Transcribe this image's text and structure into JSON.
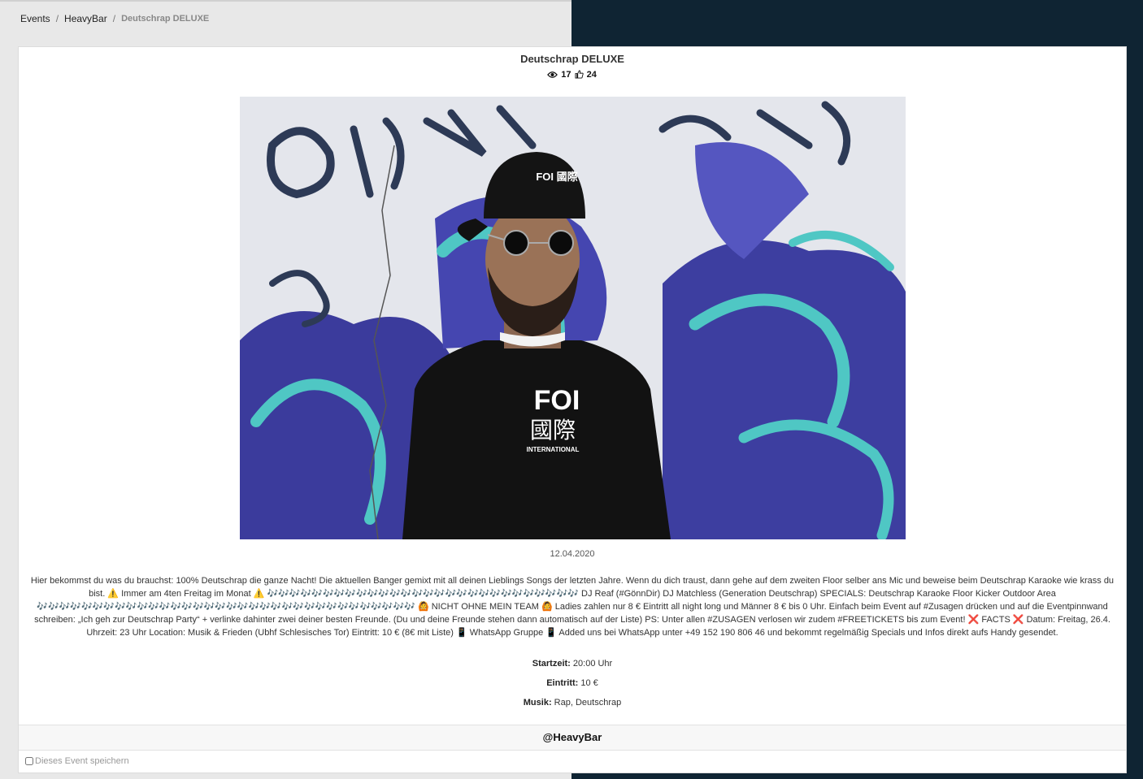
{
  "breadcrumb": {
    "items": [
      "Events",
      "HeavyBar"
    ],
    "separator": "/",
    "current": "Deutschrap DELUXE"
  },
  "event": {
    "title": "Deutschrap DELUXE",
    "views": "17",
    "likes": "24",
    "date": "12.04.2020",
    "description": "Hier bekommst du was du brauchst: 100% Deutschrap die ganze Nacht! Die aktuellen Banger gemixt mit all deinen Lieblings Songs der letzten Jahre. Wenn du dich traust, dann gehe auf dem zweiten Floor selber ans Mic und beweise beim Deutschrap Karaoke wie krass du bist. ⚠️ Immer am 4ten Freitag im Monat ⚠️ 🎶🎶🎶🎶🎶🎶🎶🎶🎶🎶🎶🎶🎶🎶🎶🎶🎶🎶🎶🎶🎶🎶🎶🎶🎶🎶🎶🎶 DJ Reaf (#GönnDir) DJ Matchless (Generation Deutschrap) SPECIALS: Deutschrap Karaoke Floor Kicker Outdoor Area 🎶🎶🎶🎶🎶🎶🎶🎶🎶🎶🎶🎶🎶🎶🎶🎶🎶🎶🎶🎶🎶🎶🎶🎶🎶🎶🎶🎶🎶🎶🎶🎶🎶🎶 🙆 NICHT OHNE MEIN TEAM 🙆 Ladies zahlen nur 8 € Eintritt all night long und Männer 8 € bis 0 Uhr. Einfach beim Event auf #Zusagen drücken und auf die Eventpinnwand schreiben: „Ich geh zur Deutschrap Party“ + verlinke dahinter zwei deiner besten Freunde. (Du und deine Freunde stehen dann automatisch auf der Liste) PS: Unter allen #ZUSAGEN verlosen wir zudem #FREETICKETS bis zum Event! ❌ FACTS ❌ Datum: Freitag, 26.4. Uhrzeit: 23 Uhr Location: Musik & Frieden (Ubhf Schlesisches Tor) Eintritt: 10 € (8€ mit Liste) 📱 WhatsApp Gruppe 📱 Added uns bei WhatsApp unter +49 152 190 806 46 und bekommt regelmäßig Specials und Infos direkt aufs Handy gesendet.",
    "details": [
      {
        "label": "Startzeit:",
        "value": "20:00 Uhr"
      },
      {
        "label": "Eintritt:",
        "value": "10 €"
      },
      {
        "label": "Musik:",
        "value": "Rap, Deutschrap"
      }
    ],
    "organizer": "@HeavyBar",
    "save_label": "Dieses Event speichern",
    "save_checked": false
  },
  "photo": {
    "cap_text": "FOI 國際",
    "shirt_text_1": "FOI",
    "shirt_text_2": "國際",
    "shirt_text_3": "INTERNATIONAL"
  },
  "colors": {
    "right_panel": "#0f2433",
    "left_panel": "#e8e8e8",
    "graffiti_blue": "#3d3ea0",
    "graffiti_cyan": "#4fc7c4"
  }
}
